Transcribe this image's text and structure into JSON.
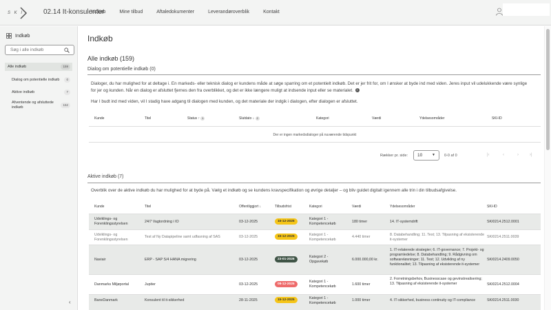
{
  "header": {
    "logo_text": "S K I",
    "brand": "02.14 It-konsulenter",
    "nav": [
      "Indkøb",
      "Mine tilbud",
      "Aftaledokumenter",
      "Leverandøroverblik",
      "Kontakt"
    ]
  },
  "sidebar": {
    "title": "Indkøb",
    "search_placeholder": "Søg i alle indkøb",
    "items": [
      {
        "label": "Alle indkøb",
        "count": "159"
      },
      {
        "label": "Dialog om potentielle indkøb",
        "count": "0"
      },
      {
        "label": "Aktive indkøb",
        "count": "7"
      },
      {
        "label": "Afventende og afsluttede indkøb",
        "count": "152"
      }
    ],
    "collapse": "‹"
  },
  "main": {
    "title": "Indkøb",
    "all_title": "Alle indkøb (159)",
    "dialog": {
      "title": "Dialog om potentielle indkøb (0)",
      "para1": "Dialoger, du har mulighed for at deltage i. En markeds- eller teknisk dialog er kundens måde at søge sparring om et potentielt indkøb. Det er jer frit for, om I ønsker at byde ind med viden. Jeres input vil udelukkende være synlige for jer og kunden. Når en dialog er afsluttet fjernes den fra overblikket, og det er ikke længere muligt at indsende input eller se materialet.",
      "para2": "Har I budt ind med viden, vil I stadig have adgang til dialogen med kunden, og det materiale der indgik i dialogen, efter dialogen er afsluttet.",
      "columns": [
        "Kunde",
        "Titel",
        "Status",
        "Slutdato",
        "Kategori",
        "Værdi",
        "Ydelsesområder",
        "SKI-ID"
      ],
      "status_sort": "1",
      "slutdato_sort": "2",
      "empty": "Der er ingen markedsdialoger på nuværende tidspunkt",
      "pager": {
        "label": "Rækker pr. side:",
        "value": "10",
        "range": "0-0 af 0"
      }
    },
    "active": {
      "title": "Aktive indkøb (7)",
      "para": "Overblik over de aktive indkøb du har mulighed for at byde på. Vælg et indkøb og se kundens kravspecifikation og øvrige detaljer – og bliv guidet digitalt igennem alle trin i din tilbudsafgivelse.",
      "columns": [
        "Kunde",
        "Titel",
        "Offentliggjort",
        "Tilbudsfrist",
        "Kategori",
        "Værdi",
        "Ydelsesområder",
        "SKI-ID"
      ],
      "rows": [
        {
          "kunde": "Udviklings- og Forenklingsstyrelsen",
          "titel": "24/7 Vagtordning i IO",
          "offentliggjort": "03-12-2025",
          "frist": "15-12-2025",
          "frist_color": "yellow",
          "kategori": "Kategori 1 - Kompetencekøb",
          "vaerdi": "180 timer",
          "ydelser": "14. IT-systemdrift",
          "ski_id": "SKI0214.2512.0001",
          "muted": false
        },
        {
          "kunde": "Udviklings- og Forenklingsstyrelsen",
          "titel": "Test af Ny Datapipeline samt udfasning af SAS",
          "offentliggjort": "03-12-2025",
          "frist": "15-12-2025",
          "frist_color": "yellow",
          "kategori": "Kategori 1 - Kompetencekøb",
          "vaerdi": "4.440 timer",
          "ydelser": "8. Databehandling; 11. Test; 13. Tilpasning af eksisterende it-systemer",
          "ski_id": "SKI0214.2511.0039",
          "muted": true
        },
        {
          "kunde": "Naviair",
          "titel": "ERP - SAP S/4 HANA migrering",
          "offentliggjort": "03-12-2025",
          "frist": "23-01-2026",
          "frist_color": "green",
          "kategori": "Kategori 2 - Opgavekøb",
          "vaerdi": "6.000.000,00 kr.",
          "ydelser": "1. IT-relaterede strategier; 6. IT-governance; 7. Projekt- og programledelse; 8. Databehandling; 9. Rådgivning om softwareløsninger; 11. Test; 12. Udvikling af ny funktionalitet; 13. Tilpasning af eksisterende it-systemer",
          "ski_id": "SKI0214.2409.0050",
          "muted": false
        },
        {
          "kunde": "Danmarks Miljøportal",
          "titel": "Jupiter",
          "offentliggjort": "03-12-2025",
          "frist": "08-12-2025",
          "frist_color": "red",
          "kategori": "Kategori 1 - Kompetencekøb",
          "vaerdi": "1.600 timer",
          "ydelser": "2. Forretningsbehov, Businesscase og gevinstrealisering; 13. Tilpasning af eksisterende it-systemer",
          "ski_id": "SKI0214.2512.0004",
          "muted": false
        },
        {
          "kunde": "BaneDanmark",
          "titel": "Konsulent til it-sikkerhed",
          "offentliggjort": "28-11-2025",
          "frist": "15-12-2025",
          "frist_color": "yellow",
          "kategori": "Kategori 1 - Kompetencekøb",
          "vaerdi": "1.000 timer",
          "ydelser": "4. IT-sikkerhed, business continuity og IT-compliance",
          "ski_id": "SKI0214.2511.0030",
          "muted": false
        }
      ]
    }
  }
}
